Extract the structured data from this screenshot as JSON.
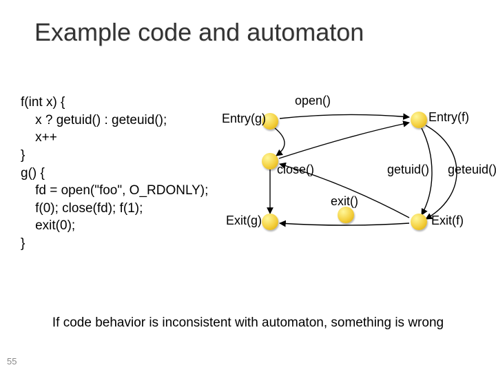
{
  "title": "Example code and automaton",
  "code": "f(int x) {\n    x ? getuid() : geteuid();\n    x++\n}\ng() {\n    fd = open(\"foo\", O_RDONLY);\n    f(0); close(fd); f(1);\n    exit(0);\n}",
  "automaton": {
    "labels": {
      "entry_g": "Entry(g)",
      "entry_f": "Entry(f)",
      "exit_g": "Exit(g)",
      "exit_f": "Exit(f)",
      "open": "open()",
      "close": "close()",
      "exit": "exit()",
      "getuid": "getuid()",
      "geteuid": "geteuid()"
    }
  },
  "footer": "If code behavior is inconsistent with automaton, something is wrong",
  "slide_number": "55"
}
